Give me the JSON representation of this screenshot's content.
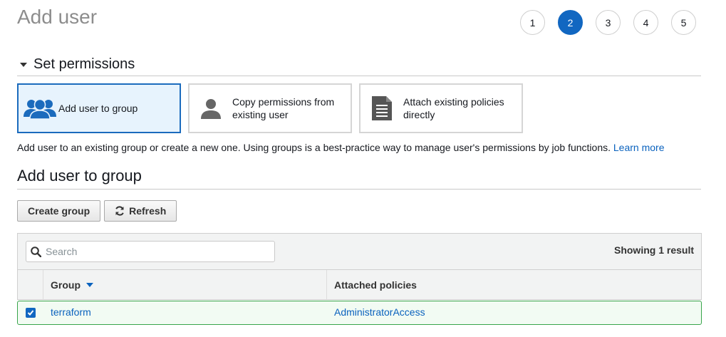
{
  "page": {
    "title": "Add user"
  },
  "steps": [
    "1",
    "2",
    "3",
    "4",
    "5"
  ],
  "active_step": "2",
  "permissions": {
    "title": "Set permissions",
    "options": [
      {
        "label": "Add user to group",
        "icon": "users-group-icon",
        "selected": true
      },
      {
        "label": "Copy permissions from existing user",
        "icon": "user-silhouette-icon",
        "selected": false
      },
      {
        "label": "Attach existing policies directly",
        "icon": "policy-document-icon",
        "selected": false
      }
    ],
    "description": "Add user to an existing group or create a new one. Using groups is a best-practice way to manage user's permissions by job functions.",
    "learn_more": "Learn more"
  },
  "group_section": {
    "title": "Add user to group",
    "create_group_label": "Create group",
    "refresh_label": "Refresh"
  },
  "table": {
    "search_placeholder": "Search",
    "search_value": "",
    "showing_text": "Showing 1 result",
    "columns": [
      "Group",
      "Attached policies"
    ],
    "rows": [
      {
        "group": "terraform",
        "attached_policies": "AdministratorAccess",
        "checked": true
      }
    ]
  },
  "colors": {
    "accent": "#1167c1",
    "link": "#0a62be",
    "selected_row_border": "#37a44a",
    "selected_option_bg": "#e7f3fd"
  }
}
